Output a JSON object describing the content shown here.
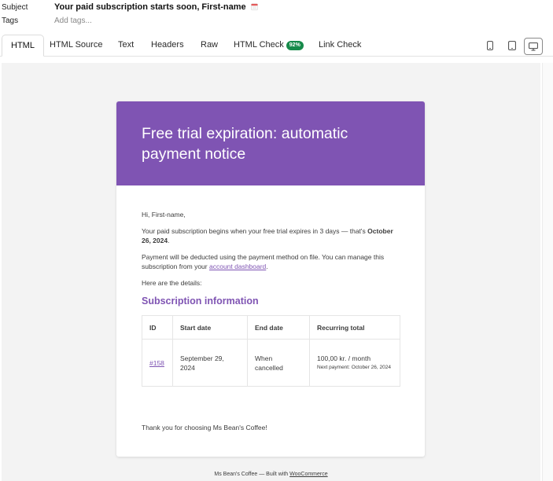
{
  "meta": {
    "subject_label": "Subject",
    "subject_value": "Your paid subscription starts soon, First-name",
    "tags_label": "Tags",
    "tags_placeholder": "Add tags..."
  },
  "tabs": [
    {
      "label": "HTML",
      "active": true
    },
    {
      "label": "HTML Source"
    },
    {
      "label": "Text"
    },
    {
      "label": "Headers"
    },
    {
      "label": "Raw"
    },
    {
      "label": "HTML Check",
      "badge": "92%"
    },
    {
      "label": "Link Check"
    }
  ],
  "devices": [
    "mobile-icon",
    "tablet-icon",
    "desktop-icon"
  ],
  "email": {
    "header_color": "#7f54b3",
    "title": "Free trial expiration: automatic payment notice",
    "greeting": "Hi, First-name,",
    "para1_prefix": "Your paid subscription begins when your free trial expires in 3 days — that's ",
    "para1_date": "October 26, 2024",
    "para1_suffix": ".",
    "para2_prefix": "Payment will be deducted using the payment method on file. You can manage this subscription from your ",
    "para2_link": "account dashboard",
    "para2_suffix": ".",
    "para3": "Here are the details:",
    "section_heading": "Subscription information",
    "table": {
      "headers": [
        "ID",
        "Start date",
        "End date",
        "Recurring total"
      ],
      "row": {
        "id": "#158",
        "start_date": "September 29, 2024",
        "end_date": "When cancelled",
        "recurring": "100,00 kr. / month",
        "next_payment": "Next payment: October 26, 2024"
      }
    },
    "thanks": "Thank you for choosing Ms Bean's Coffee!"
  },
  "footer": {
    "prefix": "Ms Bean's Coffee — Built with ",
    "link": "WooCommerce"
  }
}
